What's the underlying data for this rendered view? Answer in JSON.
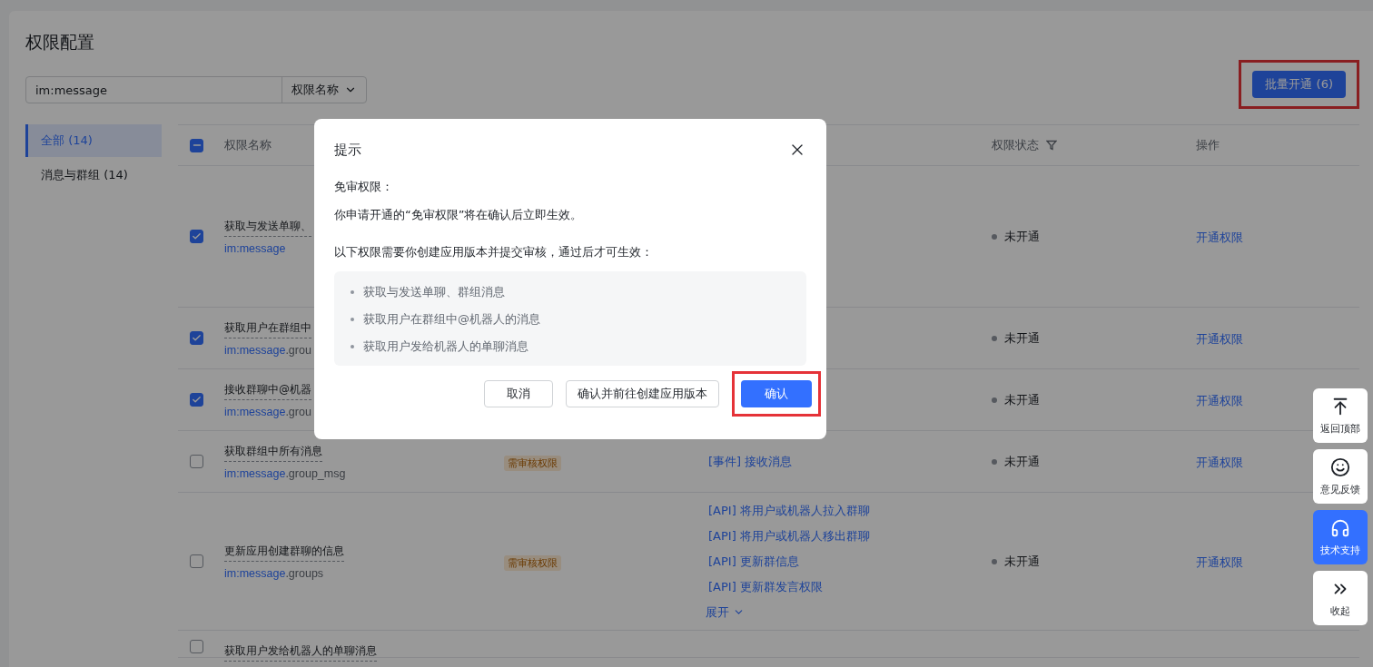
{
  "title": "权限配置",
  "search": {
    "value": "im:message",
    "field_select": "权限名称"
  },
  "batch_button": {
    "label": "批量开通 (6)",
    "highlighted": true
  },
  "sidebar": {
    "items": [
      {
        "label": "全部 (14)",
        "selected": true
      },
      {
        "label": "消息与群组 (14)",
        "selected": false
      }
    ]
  },
  "table": {
    "header_checkbox": {
      "indeterminate": true
    },
    "columns": [
      {
        "kind": "name",
        "label": "权限名称"
      },
      {
        "kind": "status",
        "label": "权限状态",
        "filter": true
      },
      {
        "kind": "action",
        "label": "操作"
      }
    ],
    "rows": [
      {
        "checked": true,
        "name": "获取与发送单聊、",
        "scope": "im:message",
        "scope_rest": "",
        "status": "未开通",
        "action": "开通权限"
      },
      {
        "checked": true,
        "name": "获取用户在群组中",
        "scope": "im:message",
        "scope_rest": ".grou",
        "status": "未开通",
        "action": "开通权限"
      },
      {
        "checked": true,
        "name": "接收群聊中@机器",
        "scope": "im:message",
        "scope_rest": ".grou",
        "status": "未开通",
        "action": "开通权限"
      },
      {
        "checked": false,
        "name": "获取群组中所有消息",
        "scope": "im:message",
        "scope_rest": ".group_msg",
        "tag": "需审核权限",
        "apis": [
          "[事件] 接收消息"
        ],
        "status": "未开通",
        "action": "开通权限"
      },
      {
        "checked": false,
        "name": "更新应用创建群聊的信息",
        "scope": "im:message",
        "scope_rest": ".groups",
        "tag": "需审核权限",
        "apis": [
          "[API] 将用户或机器人拉入群聊",
          "[API] 将用户或机器人移出群聊",
          "[API] 更新群信息",
          "[API] 更新群发言权限"
        ],
        "expand": "展开",
        "status": "未开通",
        "action": "开通权限"
      },
      {
        "checked": false,
        "name": "获取用户发给机器人的单聊消息"
      }
    ]
  },
  "dialog": {
    "title": "提示",
    "section_heading": "免审权限：",
    "section_text": "你申请开通的“免审权限”将在确认后立即生效。",
    "review_text": "以下权限需要你创建应用版本并提交审核，通过后才可生效：",
    "review_items": [
      "获取与发送单聊、群组消息",
      "获取用户在群组中@机器人的消息",
      "获取用户发给机器人的单聊消息"
    ],
    "buttons": [
      {
        "kind": "default",
        "label": "取消"
      },
      {
        "kind": "default",
        "label": "确认并前往创建应用版本"
      },
      {
        "kind": "primary",
        "label": "确认",
        "highlighted": true
      }
    ]
  },
  "float_tools": [
    {
      "kind": "top",
      "label": "返回顶部",
      "selected": false
    },
    {
      "kind": "feedback",
      "label": "意见反馈",
      "selected": false
    },
    {
      "kind": "support",
      "label": "技术支持",
      "selected": true
    },
    {
      "kind": "collapse",
      "label": "收起",
      "selected": false
    }
  ]
}
